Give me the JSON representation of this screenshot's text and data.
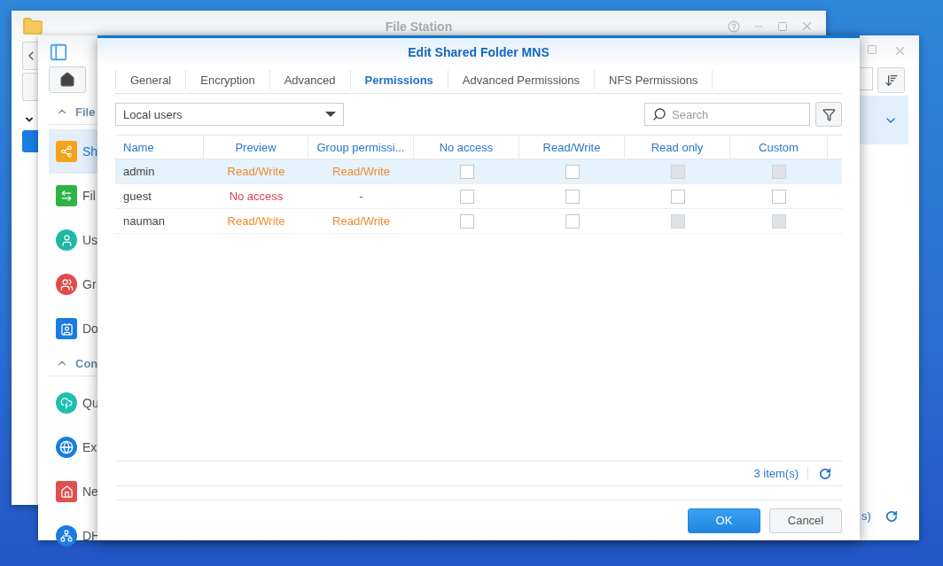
{
  "file_station": {
    "title": "File Station"
  },
  "control_panel": {
    "sidebar": [
      {
        "label": "File",
        "expanded": true,
        "items": [
          {
            "label": "Sh",
            "selected": true
          },
          {
            "label": "Fil",
            "selected": false
          },
          {
            "label": "Us",
            "selected": false
          },
          {
            "label": "Gr",
            "selected": false
          },
          {
            "label": "Do",
            "selected": false
          }
        ]
      },
      {
        "label": "Con",
        "expanded": true,
        "items": [
          {
            "label": "Qu",
            "selected": false
          },
          {
            "label": "Ex",
            "selected": false
          },
          {
            "label": "Ne",
            "selected": false
          },
          {
            "label": "DH",
            "selected": false
          }
        ]
      }
    ],
    "status": "s)"
  },
  "dialog": {
    "title": "Edit Shared Folder MNS",
    "tabs": [
      {
        "label": "General",
        "selected": false
      },
      {
        "label": "Encryption",
        "selected": false
      },
      {
        "label": "Advanced",
        "selected": false
      },
      {
        "label": "Permissions",
        "selected": true
      },
      {
        "label": "Advanced Permissions",
        "selected": false
      },
      {
        "label": "NFS Permissions",
        "selected": false
      }
    ],
    "user_type": "Local users",
    "search": {
      "placeholder": "Search"
    },
    "columns": [
      "Name",
      "Preview",
      "Group permissi...",
      "No access",
      "Read/Write",
      "Read only",
      "Custom"
    ],
    "rows": [
      {
        "name": "admin",
        "selected": true,
        "preview": {
          "text": "Read/Write",
          "kind": "read_write"
        },
        "group": {
          "text": "Read/Write",
          "kind": "read_write"
        },
        "permissions": [
          {
            "checked": false,
            "disabled": false
          },
          {
            "checked": false,
            "disabled": false
          },
          {
            "checked": false,
            "disabled": true
          },
          {
            "checked": false,
            "disabled": true
          }
        ]
      },
      {
        "name": "guest",
        "selected": false,
        "preview": {
          "text": "No access",
          "kind": "no_access"
        },
        "group": {
          "text": "-",
          "kind": "none"
        },
        "permissions": [
          {
            "checked": false,
            "disabled": false
          },
          {
            "checked": false,
            "disabled": false
          },
          {
            "checked": false,
            "disabled": false
          },
          {
            "checked": false,
            "disabled": false
          }
        ]
      },
      {
        "name": "nauman",
        "selected": false,
        "preview": {
          "text": "Read/Write",
          "kind": "read_write"
        },
        "group": {
          "text": "Read/Write",
          "kind": "read_write"
        },
        "permissions": [
          {
            "checked": false,
            "disabled": false
          },
          {
            "checked": false,
            "disabled": false
          },
          {
            "checked": false,
            "disabled": true
          },
          {
            "checked": false,
            "disabled": true
          }
        ]
      }
    ],
    "count": "3 item(s)",
    "buttons": [
      {
        "label": "OK",
        "kind": "primary"
      },
      {
        "label": "Cancel",
        "kind": "secondary"
      }
    ]
  }
}
